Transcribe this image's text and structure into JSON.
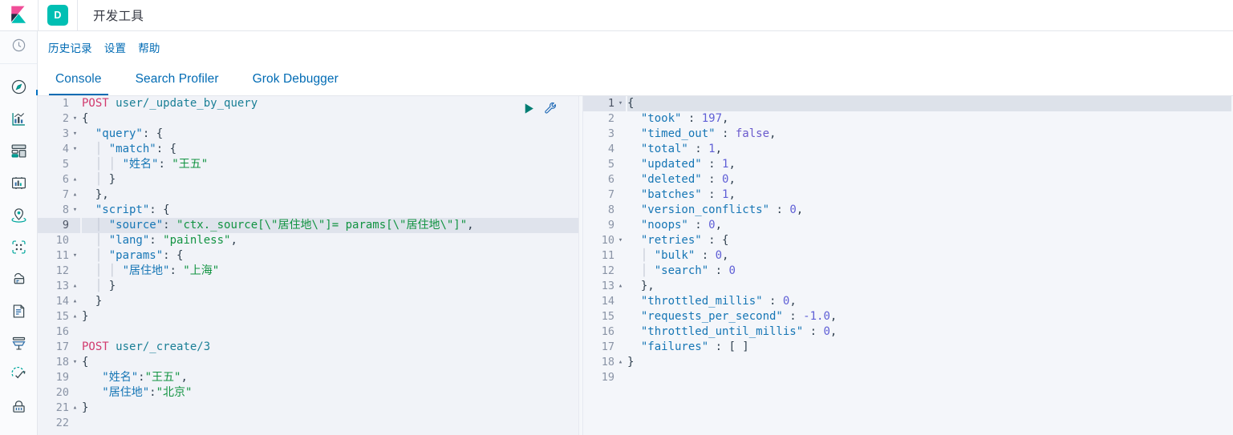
{
  "header": {
    "logo_icon": "kibana-logo",
    "app_badge_letter": "D",
    "app_title": "开发工具",
    "badge_color": "#00bfb3"
  },
  "subnav": {
    "items": [
      {
        "label": "历史记录",
        "name": "history"
      },
      {
        "label": "设置",
        "name": "settings"
      },
      {
        "label": "帮助",
        "name": "help"
      }
    ]
  },
  "tabs": [
    {
      "label": "Console",
      "active": true
    },
    {
      "label": "Search Profiler",
      "active": false
    },
    {
      "label": "Grok Debugger",
      "active": false
    }
  ],
  "sidebar": {
    "icons": [
      "clock-icon",
      "compass-icon",
      "visualize-chart-icon",
      "dashboard-icon",
      "canvas-icon",
      "maps-pin-icon",
      "machine-learning-icon",
      "infrastructure-icon",
      "logs-document-icon",
      "apm-icon",
      "uptime-check-icon",
      "security-lock-icon"
    ]
  },
  "actions": {
    "play_label": "play-icon",
    "wrench_label": "wrench-icon"
  },
  "request_editor": {
    "active_line": 9,
    "total_lines": 22,
    "lines": [
      {
        "n": 1,
        "fold": "",
        "tokens": [
          {
            "t": "method",
            "v": "POST"
          },
          {
            "t": "plain",
            "v": " "
          },
          {
            "t": "url",
            "v": "user/_update_by_query"
          }
        ]
      },
      {
        "n": 2,
        "fold": "▾",
        "tokens": [
          {
            "t": "brace",
            "v": "{"
          }
        ]
      },
      {
        "n": 3,
        "fold": "▾",
        "tokens": [
          {
            "t": "plain",
            "v": "  "
          },
          {
            "t": "key",
            "v": "\"query\""
          },
          {
            "t": "punct",
            "v": ": {"
          }
        ]
      },
      {
        "n": 4,
        "fold": "▾",
        "tokens": [
          {
            "t": "guide",
            "v": "  │ "
          },
          {
            "t": "key",
            "v": "\"match\""
          },
          {
            "t": "punct",
            "v": ": {"
          }
        ]
      },
      {
        "n": 5,
        "fold": "",
        "tokens": [
          {
            "t": "guide",
            "v": "  │ │ "
          },
          {
            "t": "key",
            "v": "\"姓名\""
          },
          {
            "t": "punct",
            "v": ": "
          },
          {
            "t": "str",
            "v": "\"王五\""
          }
        ]
      },
      {
        "n": 6,
        "fold": "▴",
        "tokens": [
          {
            "t": "guide",
            "v": "  │ "
          },
          {
            "t": "punct",
            "v": "}"
          }
        ]
      },
      {
        "n": 7,
        "fold": "▴",
        "tokens": [
          {
            "t": "plain",
            "v": "  "
          },
          {
            "t": "punct",
            "v": "},"
          }
        ]
      },
      {
        "n": 8,
        "fold": "▾",
        "tokens": [
          {
            "t": "plain",
            "v": "  "
          },
          {
            "t": "key",
            "v": "\"script\""
          },
          {
            "t": "punct",
            "v": ": {"
          }
        ]
      },
      {
        "n": 9,
        "fold": "",
        "tokens": [
          {
            "t": "guide",
            "v": "  │ "
          },
          {
            "t": "key",
            "v": "\"source\""
          },
          {
            "t": "punct",
            "v": ": "
          },
          {
            "t": "str",
            "v": "\"ctx._source[\\\"居住地\\\"]= params[\\\"居住地\\\"]\""
          },
          {
            "t": "punct",
            "v": ","
          }
        ]
      },
      {
        "n": 10,
        "fold": "",
        "tokens": [
          {
            "t": "guide",
            "v": "  │ "
          },
          {
            "t": "key",
            "v": "\"lang\""
          },
          {
            "t": "punct",
            "v": ": "
          },
          {
            "t": "str",
            "v": "\"painless\""
          },
          {
            "t": "punct",
            "v": ","
          }
        ]
      },
      {
        "n": 11,
        "fold": "▾",
        "tokens": [
          {
            "t": "guide",
            "v": "  │ "
          },
          {
            "t": "key",
            "v": "\"params\""
          },
          {
            "t": "punct",
            "v": ": {"
          }
        ]
      },
      {
        "n": 12,
        "fold": "",
        "tokens": [
          {
            "t": "guide",
            "v": "  │ │ "
          },
          {
            "t": "key",
            "v": "\"居住地\""
          },
          {
            "t": "punct",
            "v": ": "
          },
          {
            "t": "str",
            "v": "\"上海\""
          }
        ]
      },
      {
        "n": 13,
        "fold": "▴",
        "tokens": [
          {
            "t": "guide",
            "v": "  │ "
          },
          {
            "t": "punct",
            "v": "}"
          }
        ]
      },
      {
        "n": 14,
        "fold": "▴",
        "tokens": [
          {
            "t": "plain",
            "v": "  "
          },
          {
            "t": "punct",
            "v": "}"
          }
        ]
      },
      {
        "n": 15,
        "fold": "▴",
        "tokens": [
          {
            "t": "brace",
            "v": "}"
          }
        ]
      },
      {
        "n": 16,
        "fold": "",
        "tokens": []
      },
      {
        "n": 17,
        "fold": "",
        "tokens": [
          {
            "t": "method",
            "v": "POST"
          },
          {
            "t": "plain",
            "v": " "
          },
          {
            "t": "url",
            "v": "user/_create/3"
          }
        ]
      },
      {
        "n": 18,
        "fold": "▾",
        "tokens": [
          {
            "t": "brace",
            "v": "{"
          }
        ]
      },
      {
        "n": 19,
        "fold": "",
        "tokens": [
          {
            "t": "plain",
            "v": "   "
          },
          {
            "t": "key",
            "v": "\"姓名\""
          },
          {
            "t": "punct",
            "v": ":"
          },
          {
            "t": "str",
            "v": "\"王五\""
          },
          {
            "t": "punct",
            "v": ","
          }
        ]
      },
      {
        "n": 20,
        "fold": "",
        "tokens": [
          {
            "t": "plain",
            "v": "   "
          },
          {
            "t": "key",
            "v": "\"居住地\""
          },
          {
            "t": "punct",
            "v": ":"
          },
          {
            "t": "str",
            "v": "\"北京\""
          }
        ]
      },
      {
        "n": 21,
        "fold": "▴",
        "tokens": [
          {
            "t": "brace",
            "v": "}"
          }
        ]
      },
      {
        "n": 22,
        "fold": "",
        "tokens": []
      }
    ]
  },
  "response_editor": {
    "active_line": 1,
    "total_lines": 19,
    "lines": [
      {
        "n": 1,
        "fold": "▾",
        "tokens": [
          {
            "t": "brace",
            "v": "{"
          }
        ]
      },
      {
        "n": 2,
        "fold": "",
        "tokens": [
          {
            "t": "plain",
            "v": "  "
          },
          {
            "t": "key",
            "v": "\"took\""
          },
          {
            "t": "punct",
            "v": " : "
          },
          {
            "t": "num",
            "v": "197"
          },
          {
            "t": "punct",
            "v": ","
          }
        ]
      },
      {
        "n": 3,
        "fold": "",
        "tokens": [
          {
            "t": "plain",
            "v": "  "
          },
          {
            "t": "key",
            "v": "\"timed_out\""
          },
          {
            "t": "punct",
            "v": " : "
          },
          {
            "t": "bool",
            "v": "false"
          },
          {
            "t": "punct",
            "v": ","
          }
        ]
      },
      {
        "n": 4,
        "fold": "",
        "tokens": [
          {
            "t": "plain",
            "v": "  "
          },
          {
            "t": "key",
            "v": "\"total\""
          },
          {
            "t": "punct",
            "v": " : "
          },
          {
            "t": "num",
            "v": "1"
          },
          {
            "t": "punct",
            "v": ","
          }
        ]
      },
      {
        "n": 5,
        "fold": "",
        "tokens": [
          {
            "t": "plain",
            "v": "  "
          },
          {
            "t": "key",
            "v": "\"updated\""
          },
          {
            "t": "punct",
            "v": " : "
          },
          {
            "t": "num",
            "v": "1"
          },
          {
            "t": "punct",
            "v": ","
          }
        ]
      },
      {
        "n": 6,
        "fold": "",
        "tokens": [
          {
            "t": "plain",
            "v": "  "
          },
          {
            "t": "key",
            "v": "\"deleted\""
          },
          {
            "t": "punct",
            "v": " : "
          },
          {
            "t": "num",
            "v": "0"
          },
          {
            "t": "punct",
            "v": ","
          }
        ]
      },
      {
        "n": 7,
        "fold": "",
        "tokens": [
          {
            "t": "plain",
            "v": "  "
          },
          {
            "t": "key",
            "v": "\"batches\""
          },
          {
            "t": "punct",
            "v": " : "
          },
          {
            "t": "num",
            "v": "1"
          },
          {
            "t": "punct",
            "v": ","
          }
        ]
      },
      {
        "n": 8,
        "fold": "",
        "tokens": [
          {
            "t": "plain",
            "v": "  "
          },
          {
            "t": "key",
            "v": "\"version_conflicts\""
          },
          {
            "t": "punct",
            "v": " : "
          },
          {
            "t": "num",
            "v": "0"
          },
          {
            "t": "punct",
            "v": ","
          }
        ]
      },
      {
        "n": 9,
        "fold": "",
        "tokens": [
          {
            "t": "plain",
            "v": "  "
          },
          {
            "t": "key",
            "v": "\"noops\""
          },
          {
            "t": "punct",
            "v": " : "
          },
          {
            "t": "num",
            "v": "0"
          },
          {
            "t": "punct",
            "v": ","
          }
        ]
      },
      {
        "n": 10,
        "fold": "▾",
        "tokens": [
          {
            "t": "plain",
            "v": "  "
          },
          {
            "t": "key",
            "v": "\"retries\""
          },
          {
            "t": "punct",
            "v": " : {"
          }
        ]
      },
      {
        "n": 11,
        "fold": "",
        "tokens": [
          {
            "t": "guide",
            "v": "  │ "
          },
          {
            "t": "key",
            "v": "\"bulk\""
          },
          {
            "t": "punct",
            "v": " : "
          },
          {
            "t": "num",
            "v": "0"
          },
          {
            "t": "punct",
            "v": ","
          }
        ]
      },
      {
        "n": 12,
        "fold": "",
        "tokens": [
          {
            "t": "guide",
            "v": "  │ "
          },
          {
            "t": "key",
            "v": "\"search\""
          },
          {
            "t": "punct",
            "v": " : "
          },
          {
            "t": "num",
            "v": "0"
          }
        ]
      },
      {
        "n": 13,
        "fold": "▴",
        "tokens": [
          {
            "t": "plain",
            "v": "  "
          },
          {
            "t": "punct",
            "v": "},"
          }
        ]
      },
      {
        "n": 14,
        "fold": "",
        "tokens": [
          {
            "t": "plain",
            "v": "  "
          },
          {
            "t": "key",
            "v": "\"throttled_millis\""
          },
          {
            "t": "punct",
            "v": " : "
          },
          {
            "t": "num",
            "v": "0"
          },
          {
            "t": "punct",
            "v": ","
          }
        ]
      },
      {
        "n": 15,
        "fold": "",
        "tokens": [
          {
            "t": "plain",
            "v": "  "
          },
          {
            "t": "key",
            "v": "\"requests_per_second\""
          },
          {
            "t": "punct",
            "v": " : "
          },
          {
            "t": "num",
            "v": "-1.0"
          },
          {
            "t": "punct",
            "v": ","
          }
        ]
      },
      {
        "n": 16,
        "fold": "",
        "tokens": [
          {
            "t": "plain",
            "v": "  "
          },
          {
            "t": "key",
            "v": "\"throttled_until_millis\""
          },
          {
            "t": "punct",
            "v": " : "
          },
          {
            "t": "num",
            "v": "0"
          },
          {
            "t": "punct",
            "v": ","
          }
        ]
      },
      {
        "n": 17,
        "fold": "",
        "tokens": [
          {
            "t": "plain",
            "v": "  "
          },
          {
            "t": "key",
            "v": "\"failures\""
          },
          {
            "t": "punct",
            "v": " : "
          },
          {
            "t": "punct",
            "v": "[ ]"
          }
        ]
      },
      {
        "n": 18,
        "fold": "▴",
        "tokens": [
          {
            "t": "brace",
            "v": "}"
          }
        ]
      },
      {
        "n": 19,
        "fold": "",
        "tokens": []
      }
    ]
  }
}
